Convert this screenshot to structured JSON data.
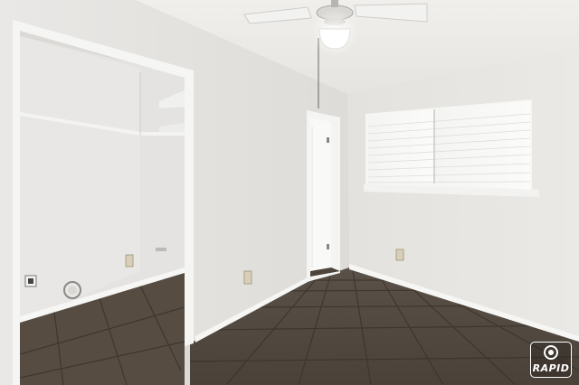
{
  "watermark": {
    "text": "RAPID",
    "icon": "camera-icon"
  },
  "colors": {
    "wall": "#e7e5e2",
    "ceiling": "#efedea",
    "floor": "#4f463d",
    "grout": "#3a332c",
    "trim": "#f8f8f6",
    "closet_wall": "#e2e1df",
    "watermark": "#ffffff"
  }
}
